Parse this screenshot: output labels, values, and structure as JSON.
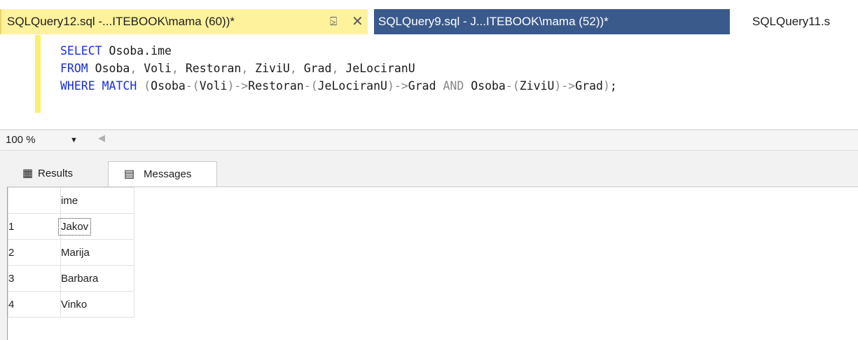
{
  "tabs": [
    {
      "label": "SQLQuery12.sql -...ITEBOOK\\mama (60))*",
      "active": true
    },
    {
      "label": "SQLQuery9.sql - J...ITEBOOK\\mama (52))*",
      "active": false
    },
    {
      "label": "SQLQuery11.s",
      "active": false
    }
  ],
  "tab_icons": {
    "pin": "⍄",
    "close": "✕"
  },
  "editor": {
    "lines": [
      "SELECT Osoba.ime",
      "FROM Osoba, Voli, Restoran, ZiviU, Grad, JeLociranU",
      "WHERE MATCH (Osoba-(Voli)->Restoran-(JeLociranU)->Grad AND Osoba-(ZiviU)->Grad);"
    ]
  },
  "zoom": {
    "value": "100 %"
  },
  "results_tabs": {
    "results": "Results",
    "messages": "Messages"
  },
  "grid": {
    "columns": [
      "ime"
    ],
    "rows": [
      {
        "num": "1",
        "ime": "Jakov"
      },
      {
        "num": "2",
        "ime": "Marija"
      },
      {
        "num": "3",
        "ime": "Barbara"
      },
      {
        "num": "4",
        "ime": "Vinko"
      }
    ]
  },
  "colors": {
    "active_tab": "#fff29d",
    "inactive_tab": "#3a5a8c",
    "keyword": "#1a2fd6",
    "function": "#d01ccd",
    "operator": "#888888"
  }
}
